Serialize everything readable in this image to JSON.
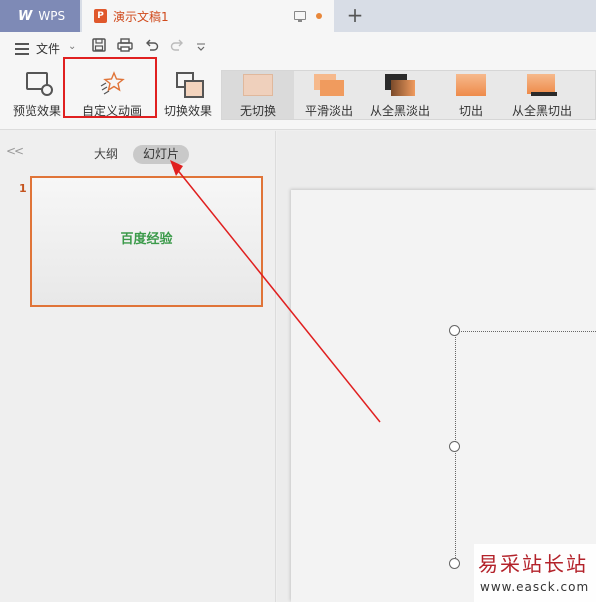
{
  "tabbar": {
    "app_tab_label": "WPS",
    "doc_tab_label": "演示文稿1",
    "doc_icon_letter": "P",
    "new_tab_symbol": "+"
  },
  "menu": {
    "file_label": "文件"
  },
  "ribbon": {
    "preview_label": "预览效果",
    "custom_anim_label": "自定义动画",
    "switch_effect_label": "切换效果",
    "transitions": [
      {
        "label": "无切换",
        "selected": true
      },
      {
        "label": "平滑淡出",
        "selected": false
      },
      {
        "label": "从全黑淡出",
        "selected": false
      },
      {
        "label": "切出",
        "selected": false
      },
      {
        "label": "从全黑切出",
        "selected": false
      }
    ]
  },
  "leftpane": {
    "collapse_symbol": "<<",
    "outline_tab": "大纲",
    "slides_tab": "幻灯片",
    "slides": [
      {
        "number": "1",
        "title": "百度经验"
      }
    ]
  },
  "watermark": {
    "title": "易采站长站",
    "url": "www.easck.com"
  },
  "colors": {
    "accent_orange": "#e07438",
    "annotation_red": "#e02020",
    "slide_title_green": "#3b9a4a"
  }
}
